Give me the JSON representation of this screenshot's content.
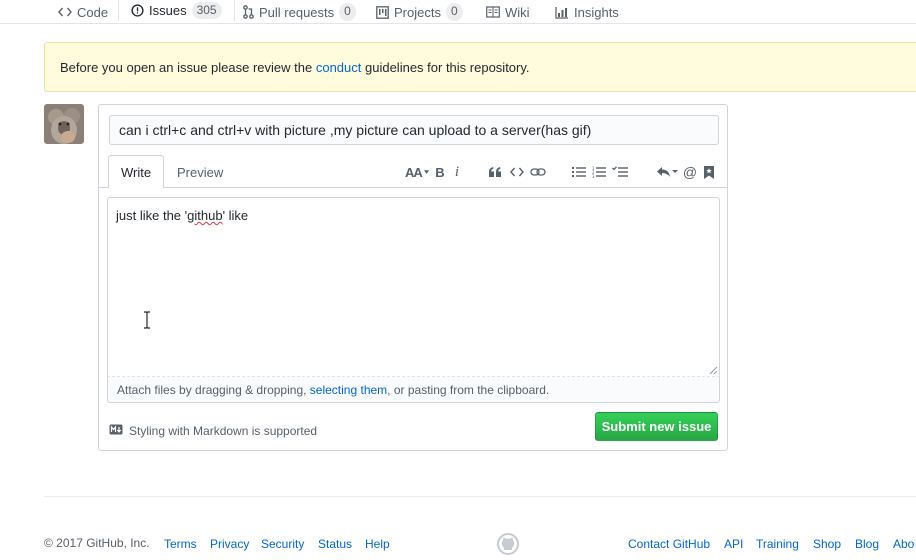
{
  "nav": {
    "code": "Code",
    "issues": "Issues",
    "issues_count": "305",
    "pulls": "Pull requests",
    "pulls_count": "0",
    "projects": "Projects",
    "projects_count": "0",
    "wiki": "Wiki",
    "insights": "Insights"
  },
  "flash": {
    "before": "Before you open an issue please review the ",
    "link": "conduct",
    "after": " guidelines for this repository."
  },
  "issue": {
    "title_value": "can i ctrl+c and ctrl+v with picture ,my picture can upload to a server(has gif)",
    "tab_write": "Write",
    "tab_preview": "Preview",
    "body_before": "just like the '",
    "body_misspelled": "github",
    "body_after": "' like",
    "attach_before": "Attach files by dragging & dropping, ",
    "attach_link": "selecting them",
    "attach_after": ", or pasting from the clipboard.",
    "markdown_note": "Styling with Markdown is supported",
    "submit_label": "Submit new issue"
  },
  "toolbar": {
    "header": "AA",
    "bold": "B",
    "italic": "i",
    "mention": "@"
  },
  "footer": {
    "copyright": "© 2017 GitHub, Inc.",
    "left_links": [
      "Terms",
      "Privacy",
      "Security",
      "Status",
      "Help"
    ],
    "right_links": [
      "Contact GitHub",
      "API",
      "Training",
      "Shop",
      "Blog",
      "Abo"
    ]
  },
  "colors": {
    "accent_link": "#0366d6",
    "submit_green": "#28a745",
    "flash_bg": "#fffbdd",
    "tab_highlight": "#e36209"
  }
}
